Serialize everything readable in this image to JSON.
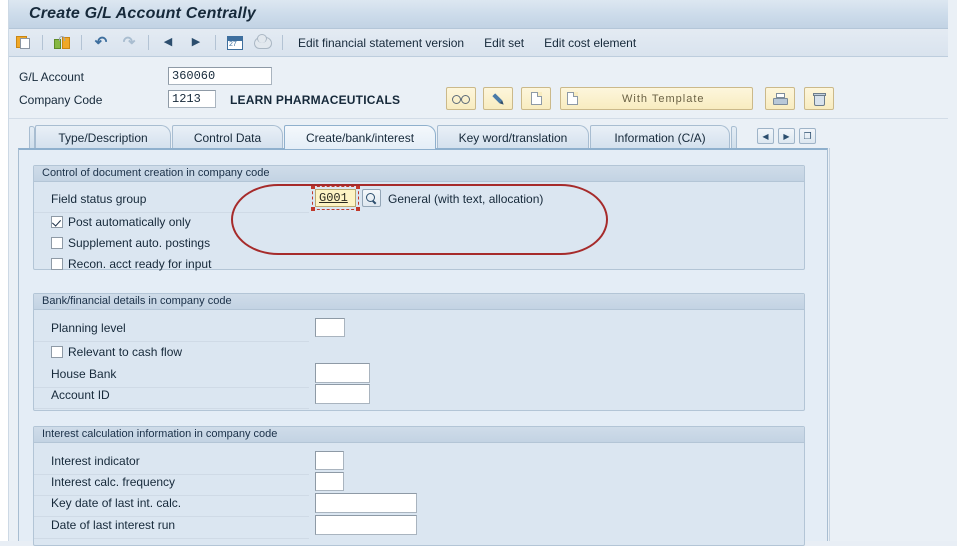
{
  "window": {
    "title": "Create G/L Account Centrally"
  },
  "toolbar": {
    "icons": [
      {
        "name": "save-icon",
        "label": "Save"
      },
      {
        "name": "lock-save-icon",
        "label": "Save as complete"
      },
      {
        "name": "undo-icon",
        "label": "Back",
        "glyph": "↶"
      },
      {
        "name": "redo-icon",
        "label": "Forward",
        "glyph": "↷"
      },
      {
        "name": "previous-icon",
        "label": "Previous",
        "glyph": "◀"
      },
      {
        "name": "next-icon",
        "label": "Next",
        "glyph": "▶"
      },
      {
        "name": "calendar-icon",
        "label": "Calendar"
      },
      {
        "name": "cloud-icon",
        "label": "Create own data"
      }
    ],
    "menus": [
      {
        "name": "edit-financial-statement-version",
        "label": "Edit financial statement version"
      },
      {
        "name": "edit-set",
        "label": "Edit set"
      },
      {
        "name": "edit-cost-element",
        "label": "Edit cost element"
      }
    ]
  },
  "header": {
    "gl_account_label": "G/L Account",
    "gl_account_value": "360060",
    "company_code_label": "Company Code",
    "company_code_value": "1213",
    "company_name": "LEARN PHARMACEUTICALS",
    "buttons": [
      {
        "name": "display-button",
        "icon": "glasses-icon",
        "label": ""
      },
      {
        "name": "edit-button",
        "icon": "pencil-icon",
        "label": ""
      },
      {
        "name": "create-button",
        "icon": "document-icon",
        "label": ""
      },
      {
        "name": "with-template-button",
        "icon": "document-icon",
        "label": "With Template"
      },
      {
        "name": "print-button",
        "icon": "printer-icon",
        "label": ""
      },
      {
        "name": "delete-button",
        "icon": "trash-icon",
        "label": ""
      }
    ]
  },
  "tabs": [
    {
      "name": "tab-type-description",
      "label": "Type/Description",
      "active": false
    },
    {
      "name": "tab-control-data",
      "label": "Control Data",
      "active": false
    },
    {
      "name": "tab-create-bank-interest",
      "label": "Create/bank/interest",
      "active": true
    },
    {
      "name": "tab-key-word-translation",
      "label": "Key word/translation",
      "active": false
    },
    {
      "name": "tab-information-ca",
      "label": "Information (C/A)",
      "active": false
    }
  ],
  "tab_nav": {
    "prev_glyph": "◀",
    "next_glyph": "▶",
    "list_glyph": "❐"
  },
  "groups": [
    {
      "name": "control-of-document-creation",
      "title": "Control of document creation in company code",
      "field_status_group": {
        "label": "Field status group",
        "value": "G001",
        "description": "General (with text, allocation)",
        "search_icon": "magnifier-icon"
      },
      "checkboxes": [
        {
          "name": "post-automatically-only",
          "label": "Post automatically only",
          "checked": true
        },
        {
          "name": "supplement-auto-postings",
          "label": "Supplement auto. postings",
          "checked": false
        },
        {
          "name": "recon-acct-ready-for-input",
          "label": "Recon. acct ready for input",
          "checked": false
        }
      ]
    },
    {
      "name": "bank-financial-details",
      "title": "Bank/financial details in company code",
      "fields": [
        {
          "name": "planning-level",
          "label": "Planning level",
          "value": "",
          "width": "narrow"
        },
        {
          "name": "house-bank",
          "label": "House Bank",
          "value": "",
          "width": "medium"
        },
        {
          "name": "account-id",
          "label": "Account ID",
          "value": "",
          "width": "medium"
        }
      ],
      "checkboxes": [
        {
          "name": "relevant-to-cash-flow",
          "label": "Relevant to cash flow",
          "checked": false
        }
      ]
    },
    {
      "name": "interest-calculation-information",
      "title": "Interest calculation information in company code",
      "fields": [
        {
          "name": "interest-indicator",
          "label": "Interest indicator",
          "value": "",
          "width": "narrow"
        },
        {
          "name": "interest-calc-frequency",
          "label": "Interest calc. frequency",
          "value": "",
          "width": "narrow"
        },
        {
          "name": "key-date-of-last-int-calc",
          "label": "Key date of last int. calc.",
          "value": "",
          "width": "wide"
        },
        {
          "name": "date-of-last-interest-run",
          "label": "Date of last interest run",
          "value": "",
          "width": "wide"
        }
      ]
    }
  ],
  "annotation": {
    "name": "red-highlight-ellipse",
    "color": "#a62b2b"
  },
  "colors": {
    "accent": "#3e6f9e",
    "panel_bg": "#e4edf6",
    "group_bg": "#dbe6f1",
    "focus_field_bg": "#fdf3c4",
    "annotation": "#a62b2b"
  }
}
